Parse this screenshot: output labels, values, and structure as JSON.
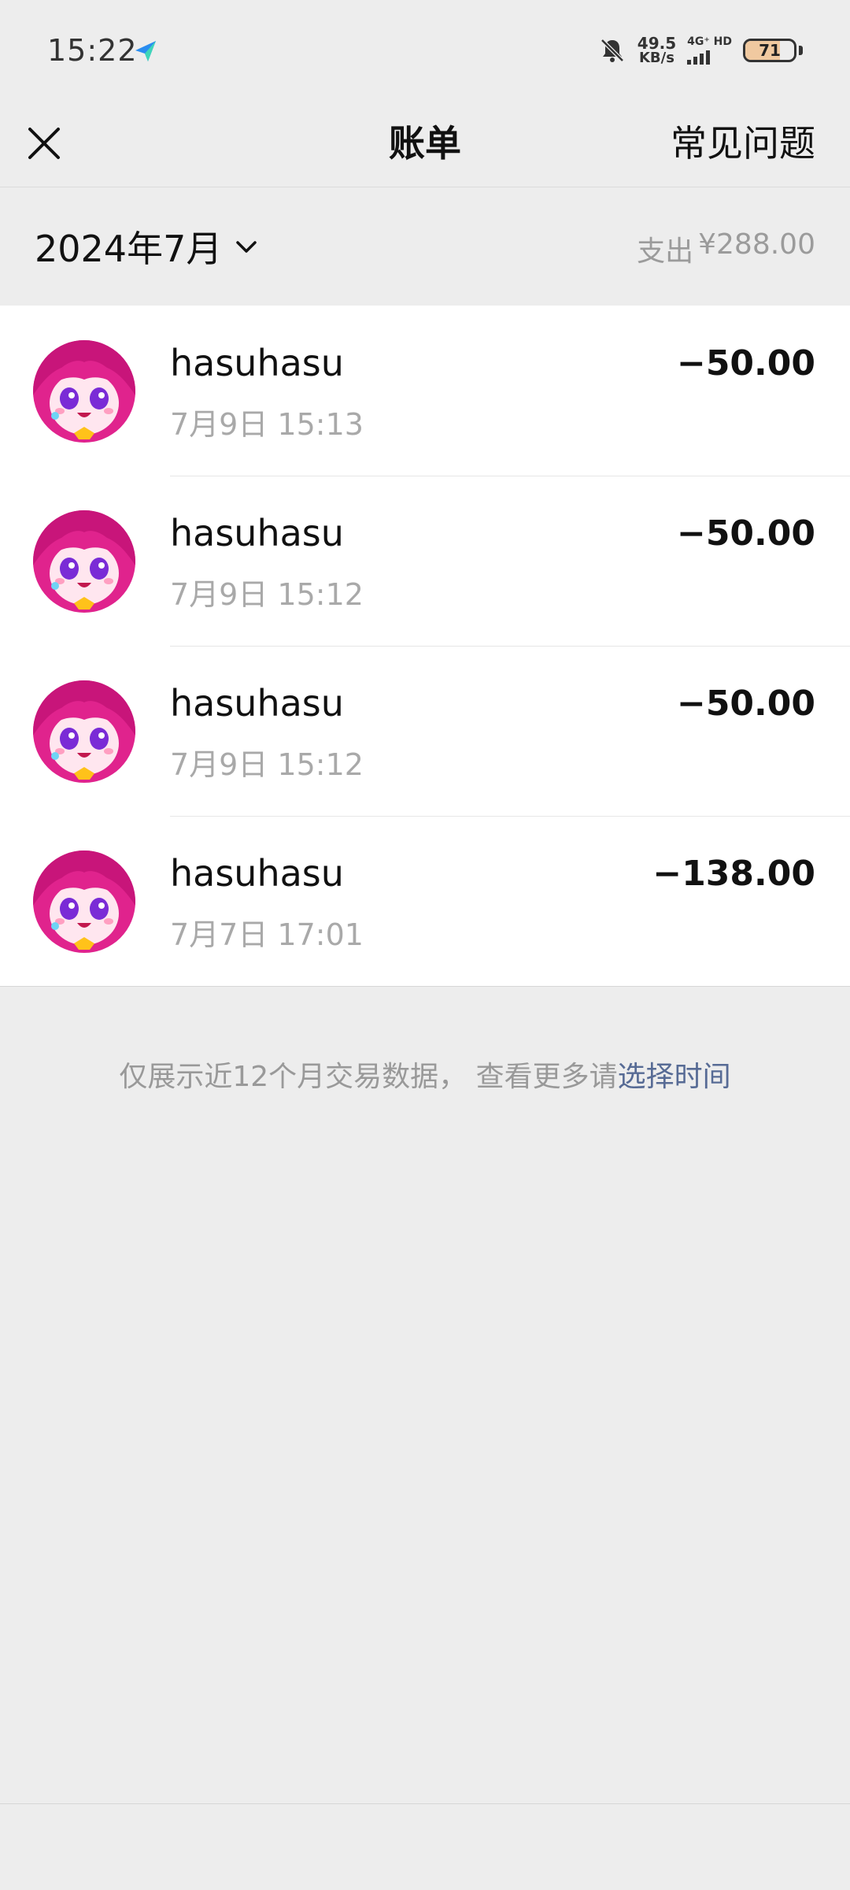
{
  "status_bar": {
    "time": "15:22",
    "speed_value": "49.5",
    "speed_unit": "KB/s",
    "network": "4G⁺ HD",
    "battery": "71",
    "battery_level": 0.71,
    "icons": [
      "app-notification-icon",
      "bell-off-icon",
      "signal-icon",
      "battery-icon"
    ]
  },
  "nav": {
    "title": "账单",
    "faq_label": "常见问题",
    "close_icon": "close-icon"
  },
  "summary": {
    "month": "2024年7月",
    "expense_label": "支出",
    "expense_amount": "¥288.00"
  },
  "transactions": [
    {
      "name": "hasuhasu",
      "time": "7月9日 15:13",
      "amount": "−50.00"
    },
    {
      "name": "hasuhasu",
      "time": "7月9日 15:12",
      "amount": "−50.00"
    },
    {
      "name": "hasuhasu",
      "time": "7月9日 15:12",
      "amount": "−50.00"
    },
    {
      "name": "hasuhasu",
      "time": "7月7日 17:01",
      "amount": "−138.00"
    }
  ],
  "footer_hint": {
    "text": "仅展示近12个月交易数据， 查看更多请",
    "link": "选择时间"
  },
  "colors": {
    "background": "#ededed",
    "link": "#576b95",
    "secondary_text": "#a9a9a9",
    "avatar_accent": "#e0238d"
  }
}
